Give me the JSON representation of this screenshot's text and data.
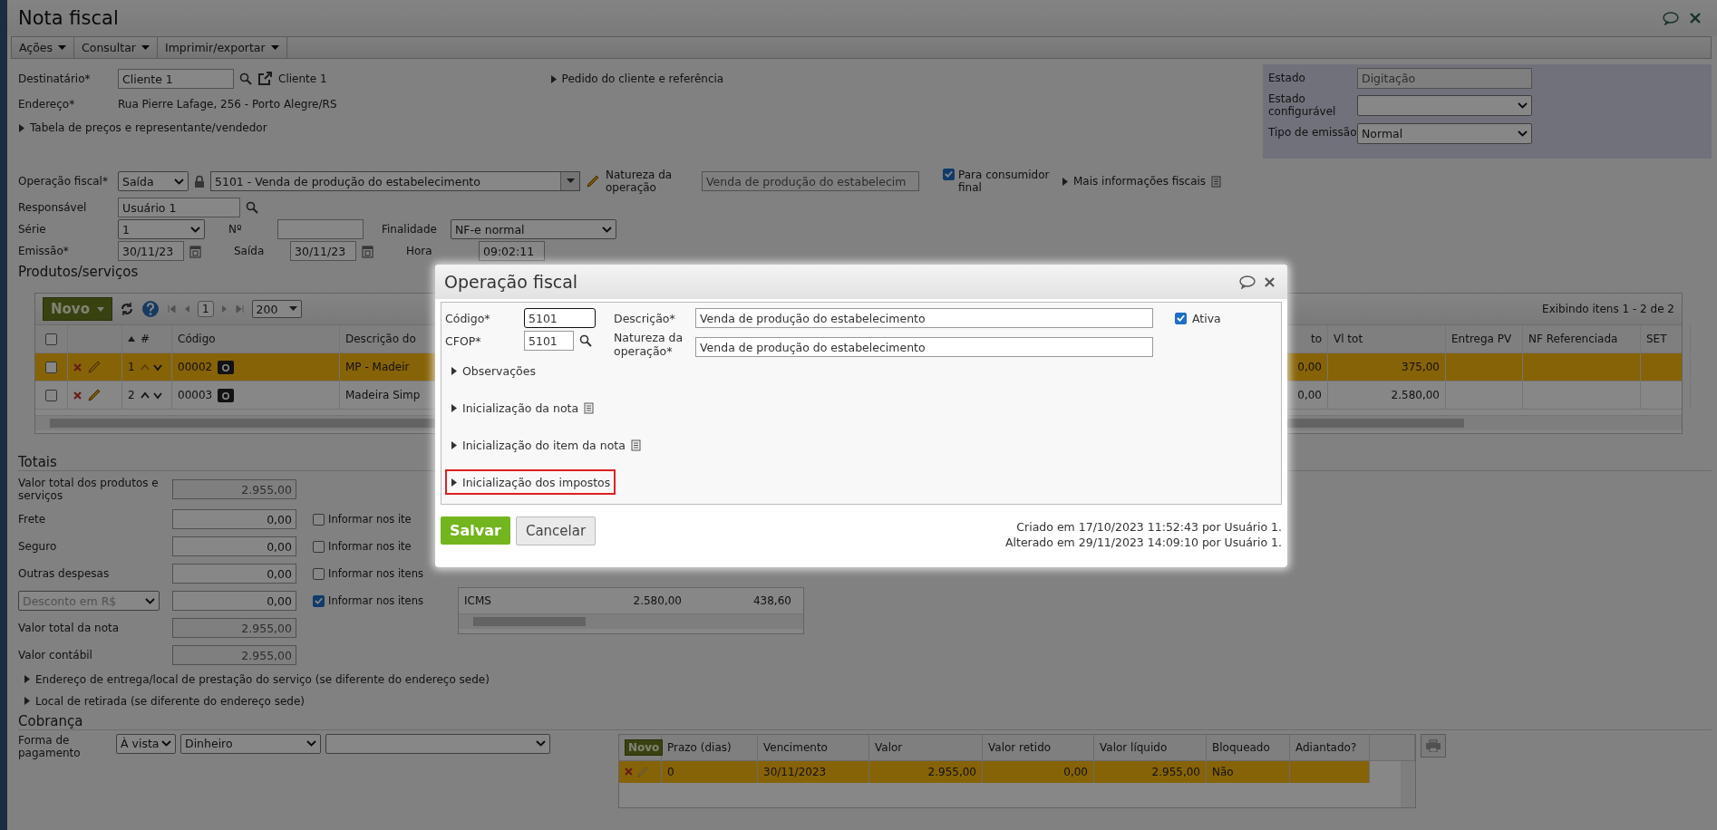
{
  "window": {
    "title": "Nota fiscal"
  },
  "menu": [
    {
      "label": "Ações"
    },
    {
      "label": "Consultar"
    },
    {
      "label": "Imprimir/exportar"
    }
  ],
  "header": {
    "destinatario": {
      "label": "Destinatário*",
      "value": "Cliente 1",
      "link": "Cliente 1"
    },
    "pedido_link": {
      "label": "Pedido do cliente e referência",
      "expanded": false
    },
    "endereco": {
      "label": "Endereço*",
      "value": "Rua Pierre Lafage, 256 - Porto Alegre/RS"
    },
    "tabela_link": {
      "label": "Tabela de preços e representante/vendedor",
      "expanded": false
    }
  },
  "status_panel": [
    {
      "label": "Estado",
      "kind": "text",
      "value": "Digitação"
    },
    {
      "label": "Estado configurável",
      "kind": "select"
    },
    {
      "label": "Tipo de emissão",
      "kind": "select",
      "value": "Normal"
    }
  ],
  "operacao": {
    "label": "Operação fiscal*",
    "tipo": "Saída",
    "value": "5101 - Venda de produção do estabelecimento",
    "natureza_label": "Natureza da operação",
    "natureza": "Venda de produção do estabelecim",
    "consumidor_final": {
      "label": "Para consumidor final",
      "checked": true
    },
    "mais_info": {
      "label": "Mais informações fiscais",
      "expanded": false
    }
  },
  "responsavel": {
    "label": "Responsável",
    "value": "Usuário 1"
  },
  "serie": {
    "label": "Série",
    "value": "1",
    "numero_label": "Nº",
    "finalidade_label": "Finalidade",
    "finalidade": "NF-e normal"
  },
  "datas": {
    "emissao_label": "Emissão*",
    "emissao": "30/11/23",
    "saida_label": "Saída",
    "saida": "30/11/23",
    "hora_label": "Hora",
    "hora": "09:02:11"
  },
  "products": {
    "title": "Produtos/serviços",
    "all_checked": false,
    "new_label": "Novo",
    "page": "1",
    "page_size": "200",
    "summary": "Exibindo itens 1 - 2 de 2",
    "columns": [
      "#",
      "Código",
      "Descrição do",
      "to",
      "Vl tot",
      "Entrega PV",
      "NF Referenciada",
      "SET"
    ],
    "rows": [
      {
        "selected": true,
        "checked": false,
        "number": "1",
        "code": "00002",
        "description": "MP - Madeir",
        "partial": "0,00",
        "total": "375,00"
      },
      {
        "selected": false,
        "checked": false,
        "number": "2",
        "code": "00003",
        "description": "Madeira Simp",
        "partial": "0,00",
        "total": "2.580,00"
      }
    ]
  },
  "totals": {
    "title": "Totais",
    "rows": [
      {
        "kind": "field",
        "label": "Valor total dos produtos e serviços",
        "value": "2.955,00",
        "readonly": true
      },
      {
        "kind": "field",
        "label": "Frete",
        "value": "0,00",
        "readonly": false,
        "inform": {
          "label": "Informar nos ite",
          "checked": false
        }
      },
      {
        "kind": "field",
        "label": "Seguro",
        "value": "0,00",
        "readonly": false,
        "inform": {
          "label": "Informar nos ite",
          "checked": false
        }
      },
      {
        "kind": "field",
        "label": "Outras despesas",
        "value": "0,00",
        "readonly": false,
        "inform": {
          "label": "Informar nos itens",
          "checked": false
        }
      },
      {
        "kind": "select",
        "label": "Desconto em R$",
        "value": "0,00",
        "readonly": false,
        "inform": {
          "label": "Informar nos itens",
          "checked": true
        }
      },
      {
        "kind": "field",
        "label": "Valor total da nota",
        "value": "2.955,00",
        "readonly": true
      },
      {
        "kind": "field",
        "label": "Valor contábil",
        "value": "2.955,00",
        "readonly": true
      }
    ]
  },
  "tax_table": {
    "rows": [
      {
        "tax": "ICMS",
        "base": "2.580,00",
        "value": "438,60"
      }
    ]
  },
  "links": [
    {
      "label": "Endereço de entrega/local de prestação do serviço (se diferente do endereço sede)",
      "expanded": false
    },
    {
      "label": "Local de retirada (se diferente do endereço sede)",
      "expanded": false
    }
  ],
  "cobranca": {
    "title": "Cobrança",
    "label": "Forma de pagamento",
    "condicao": "À vista",
    "meio": "Dinheiro",
    "new_label": "Novo",
    "columns": [
      "Prazo (dias)",
      "Vencimento",
      "Valor",
      "Valor retido",
      "Valor líquido",
      "Bloqueado",
      "Adiantado?"
    ],
    "rows": [
      {
        "selected": true,
        "cells": [
          "0",
          "30/11/2023",
          "2.955,00",
          "0,00",
          "2.955,00",
          "Não"
        ]
      }
    ]
  },
  "modal": {
    "title": "Operação fiscal",
    "codigo": {
      "label": "Código*",
      "value": "5101"
    },
    "descricao": {
      "label": "Descrição*",
      "value": "Venda de produção do estabelecimento"
    },
    "ativa": {
      "label": "Ativa",
      "checked": true
    },
    "cfop": {
      "label": "CFOP*",
      "value": "5101"
    },
    "natureza": {
      "label": "Natureza da operação*",
      "value": "Venda de produção do estabelecimento"
    },
    "sections": [
      {
        "label": "Observações",
        "expanded": false,
        "note_icon": false,
        "highlighted": false
      },
      {
        "label": "Inicialização da nota",
        "expanded": false,
        "note_icon": true,
        "highlighted": false
      },
      {
        "label": "Inicialização do item da nota",
        "expanded": false,
        "note_icon": true,
        "highlighted": false
      },
      {
        "label": "Inicialização dos impostos",
        "expanded": false,
        "note_icon": false,
        "highlighted": true
      }
    ],
    "buttons": [
      {
        "kind": "primary",
        "label": "Salvar"
      },
      {
        "kind": "secondary",
        "label": "Cancelar"
      }
    ],
    "audit": [
      "Criado em 17/10/2023 11:52:43 por Usuário 1.",
      "Alterado em 29/11/2023 14:09:10 por Usuário 1."
    ]
  }
}
